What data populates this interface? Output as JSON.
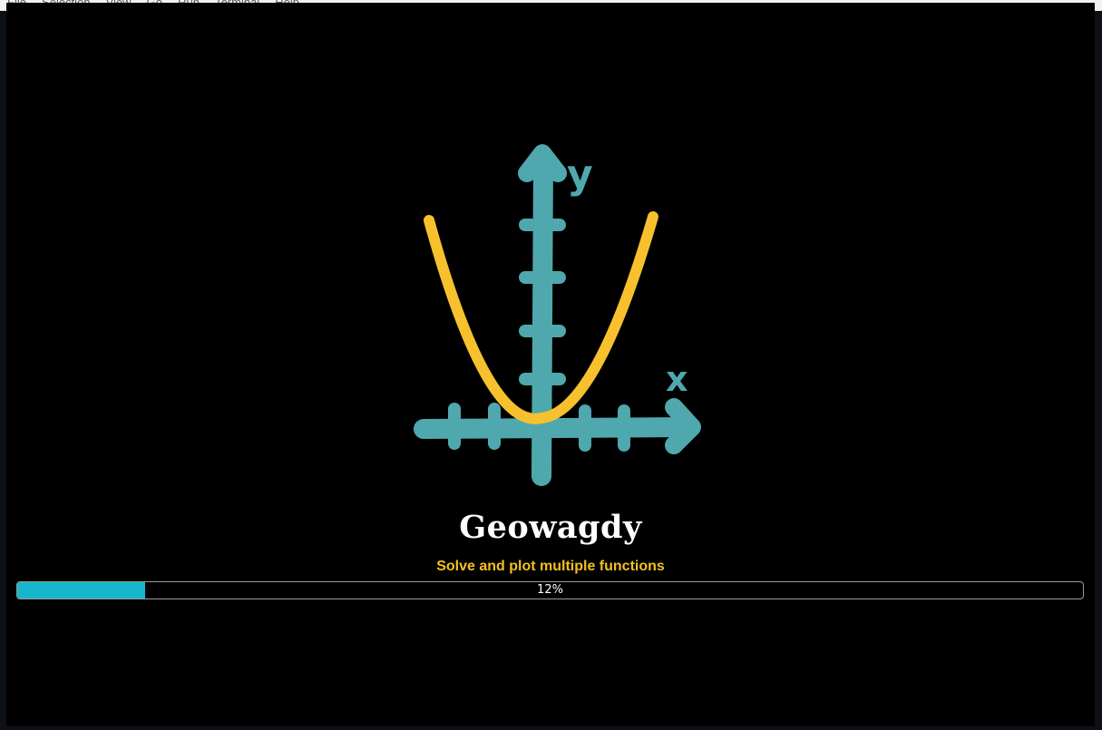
{
  "menubar": {
    "items": [
      "File",
      "Selection",
      "View",
      "Go",
      "Run",
      "Terminal",
      "Help"
    ]
  },
  "splash": {
    "app_name": "Geowagdy",
    "tagline": "Solve and plot multiple functions",
    "progress": {
      "percent": 12,
      "label": "12%"
    },
    "logo": {
      "y_axis_label": "y",
      "x_axis_label": "x",
      "axis_color": "#4fa8ae",
      "curve_color": "#f7c12e"
    }
  },
  "colors": {
    "background": "#000000",
    "tagline": "#f4c01e",
    "progress_fill": "#17b6cc",
    "progress_border": "#9a9a9a"
  }
}
